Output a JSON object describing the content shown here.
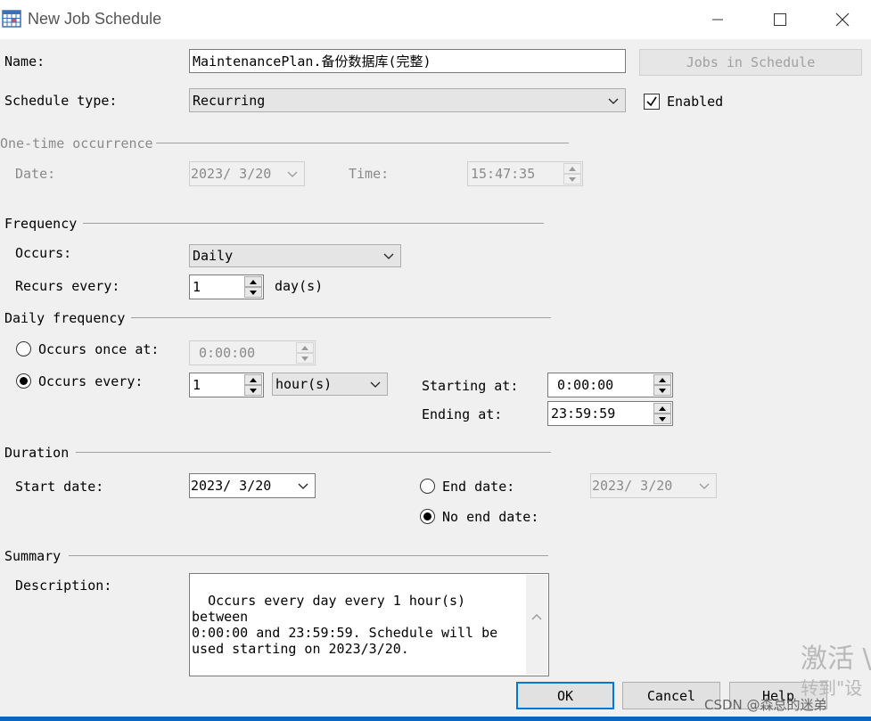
{
  "window": {
    "title": "New Job Schedule",
    "icons": {
      "app": "calendar-grid-icon",
      "minimize": "minimize-icon",
      "maximize": "maximize-icon",
      "close": "close-icon"
    }
  },
  "form": {
    "name_label": "Name:",
    "name_value": "MaintenancePlan.备份数据库(完整)",
    "jobs_button": "Jobs in Schedule",
    "schedule_type_label": "Schedule type:",
    "schedule_type_value": "Recurring",
    "enabled_label": "Enabled",
    "enabled": true
  },
  "one_time": {
    "section": "One-time occurrence",
    "date_label": "Date:",
    "date_value": "2023/ 3/20",
    "time_label": "Time:",
    "time_value": "15:47:35"
  },
  "frequency": {
    "section": "Frequency",
    "occurs_label": "Occurs:",
    "occurs_value": "Daily",
    "recurs_label": "Recurs every:",
    "recurs_value": "1",
    "recurs_unit": "day(s)"
  },
  "daily": {
    "section": "Daily frequency",
    "once_label": "Occurs once at:",
    "once_value": "0:00:00",
    "every_label": "Occurs every:",
    "every_value": "1",
    "every_unit": "hour(s)",
    "selected": "every",
    "starting_label": "Starting at:",
    "starting_value": "0:00:00",
    "ending_label": "Ending at:",
    "ending_value": "23:59:59"
  },
  "duration": {
    "section": "Duration",
    "start_label": "Start date:",
    "start_value": "2023/ 3/20",
    "end_date_label": "End date:",
    "end_date_value": "2023/ 3/20",
    "no_end_label": "No end date:",
    "selected": "no_end"
  },
  "summary": {
    "section": "Summary",
    "description_label": "Description:",
    "description": "Occurs every day every 1 hour(s) between\n0:00:00 and 23:59:59. Schedule will be\nused starting on 2023/3/20."
  },
  "buttons": {
    "ok": "OK",
    "cancel": "Cancel",
    "help": "Help"
  },
  "watermark": {
    "activate_line1": "激活 \\",
    "activate_line2": "转到\"设",
    "credit": "CSDN @森总的迷弟"
  },
  "colors": {
    "accent": "#0078d7",
    "background": "#f0f0f0",
    "disabled_text": "#8a8a8a"
  }
}
